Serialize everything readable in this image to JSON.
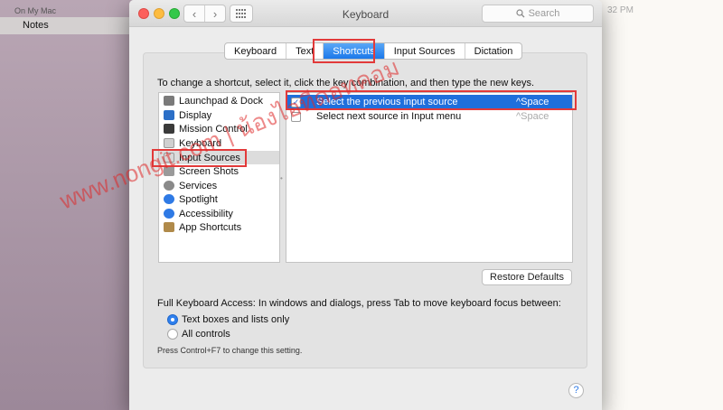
{
  "notes": {
    "section": "On My Mac",
    "item": "Notes",
    "time": "32 PM"
  },
  "window": {
    "title": "Keyboard",
    "search_placeholder": "Search"
  },
  "tabs": [
    {
      "label": "Keyboard"
    },
    {
      "label": "Text"
    },
    {
      "label": "Shortcuts",
      "active": true
    },
    {
      "label": "Input Sources"
    },
    {
      "label": "Dictation"
    }
  ],
  "instruction": "To change a shortcut, select it, click the key combination, and then type the new keys.",
  "categories": [
    {
      "label": "Launchpad & Dock",
      "icon": "launchpad-icon",
      "color": "#7a7a7a"
    },
    {
      "label": "Display",
      "icon": "display-icon",
      "color": "#2b6fc7"
    },
    {
      "label": "Mission Control",
      "icon": "mission-control-icon",
      "color": "#3a3a3a"
    },
    {
      "label": "Keyboard",
      "icon": "keyboard-icon",
      "color": "#d0d0d0"
    },
    {
      "label": "Input Sources",
      "icon": "input-sources-icon",
      "color": "#d8d8d8",
      "selected": true
    },
    {
      "label": "Screen Shots",
      "icon": "screenshot-icon",
      "color": "#9a9a9a"
    },
    {
      "label": "Services",
      "icon": "gear-icon",
      "color": "#8a8a8a"
    },
    {
      "label": "Spotlight",
      "icon": "spotlight-icon",
      "color": "#2f7ae5"
    },
    {
      "label": "Accessibility",
      "icon": "accessibility-icon",
      "color": "#2f7ae5"
    },
    {
      "label": "App Shortcuts",
      "icon": "app-shortcuts-icon",
      "color": "#b08a4a"
    }
  ],
  "shortcuts": [
    {
      "label": "Select the previous input source",
      "key": "^Space",
      "checked": true,
      "selected": true
    },
    {
      "label": "Select next source in Input menu",
      "key": "^Space",
      "checked": false,
      "selected": false
    }
  ],
  "restore_label": "Restore Defaults",
  "keyboard_access": {
    "label": "Full Keyboard Access: In windows and dialogs, press Tab to move keyboard focus between:",
    "options": [
      {
        "label": "Text boxes and lists only",
        "selected": true
      },
      {
        "label": "All controls",
        "selected": false
      }
    ],
    "hint": "Press Control+F7 to change this setting."
  },
  "help_label": "?",
  "watermark": "www.nongit.com | น้องไอทีดอทคอม",
  "colors": {
    "highlight": "#e23a3a",
    "selection": "#1f6fdc",
    "tab_active": "#1b78ea"
  }
}
